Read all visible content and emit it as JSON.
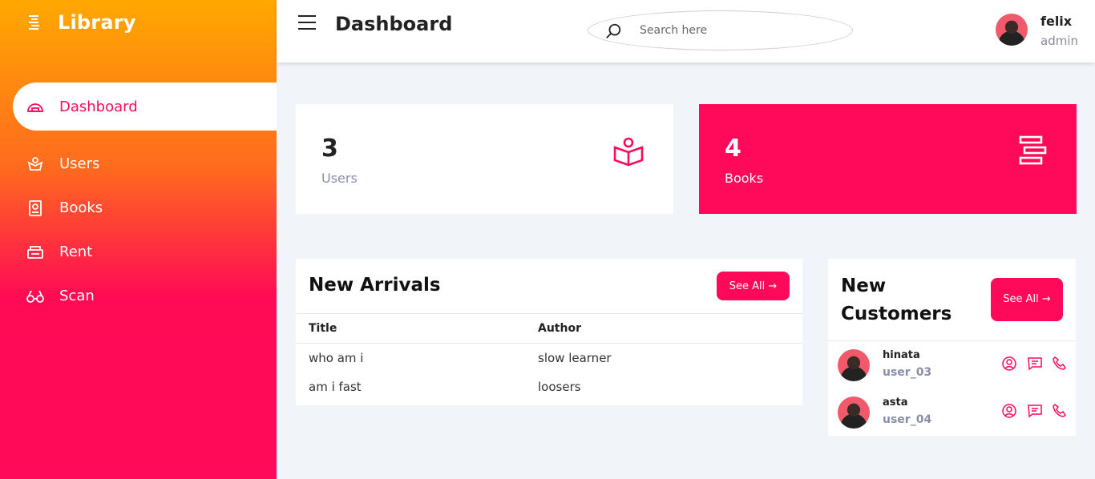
{
  "app": {
    "brand": "Library"
  },
  "sidebar": {
    "items": [
      {
        "label": "Dashboard",
        "icon": "dashboard-icon",
        "active": true
      },
      {
        "label": "Users",
        "icon": "users-icon"
      },
      {
        "label": "Books",
        "icon": "books-icon"
      },
      {
        "label": "Rent",
        "icon": "rent-icon"
      },
      {
        "label": "Scan",
        "icon": "scan-icon"
      }
    ]
  },
  "header": {
    "title": "Dashboard",
    "search_placeholder": "Search here",
    "user": {
      "name": "felix",
      "role": "admin"
    }
  },
  "cards": [
    {
      "value": "3",
      "label": "Users",
      "icon": "reader-icon"
    },
    {
      "value": "4",
      "label": "Books",
      "icon": "books-stack-icon"
    }
  ],
  "arrivals": {
    "title": "New Arrivals",
    "button": "See All →",
    "columns": [
      "Title",
      "Author"
    ],
    "rows": [
      [
        "who am i",
        "slow learner"
      ],
      [
        "am i fast",
        "loosers"
      ]
    ]
  },
  "customers": {
    "title": "New Customers",
    "button": "See All →",
    "items": [
      {
        "name": "hinata",
        "id": "user_03"
      },
      {
        "name": "asta",
        "id": "user_04"
      }
    ]
  },
  "colors": {
    "accent": "#ff0a5a",
    "gradient_top": "#ffa800",
    "background": "#f1f5f9"
  }
}
